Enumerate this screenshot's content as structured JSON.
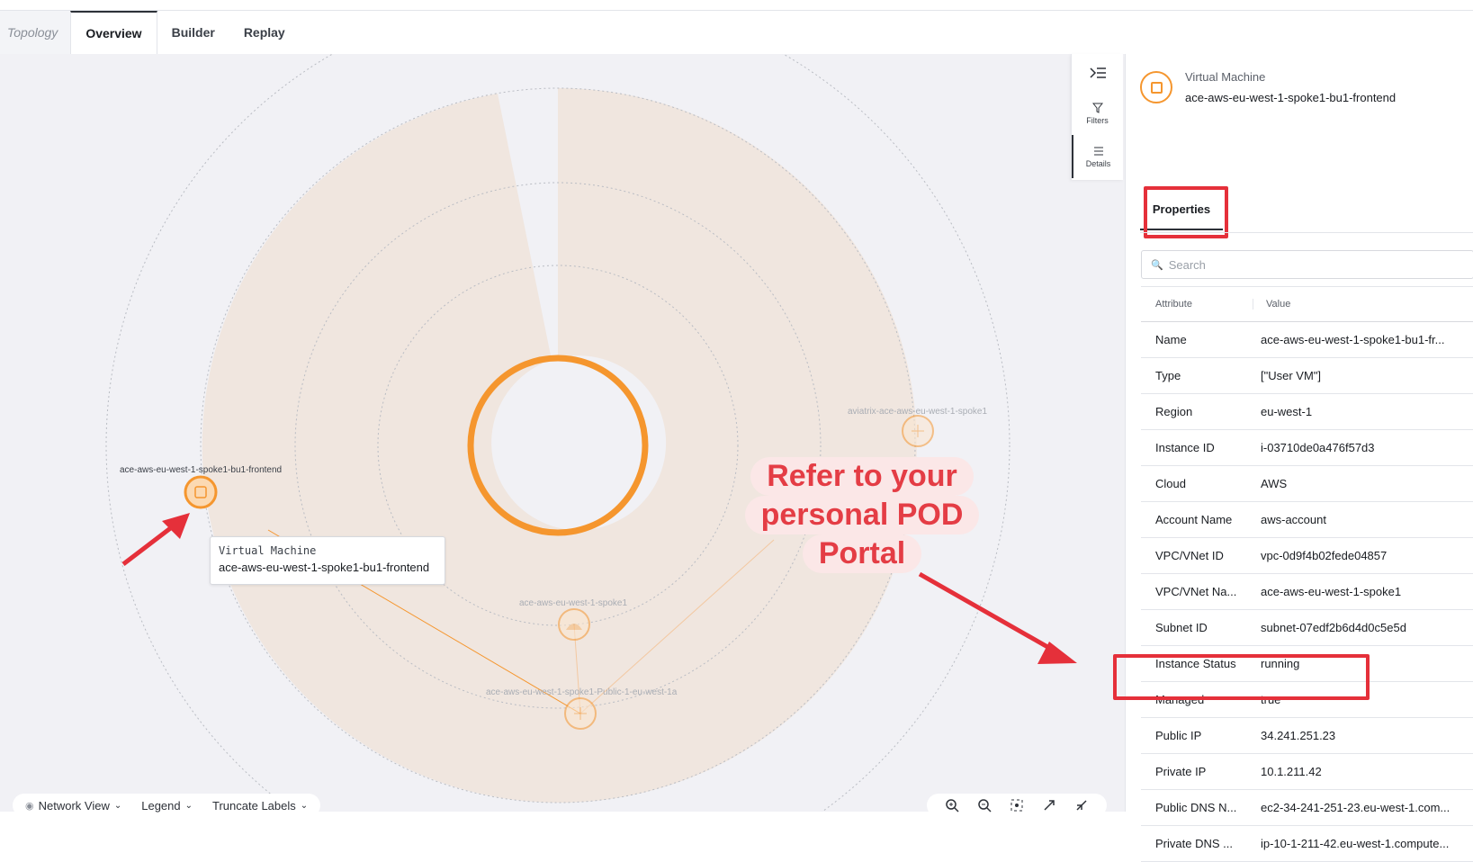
{
  "tabs": {
    "topology": "Topology",
    "overview": "Overview",
    "builder": "Builder",
    "replay": "Replay"
  },
  "canvas": {
    "node_labels": {
      "frontend": "ace-aws-eu-west-1-spoke1-bu1-frontend",
      "spoke_gw": "aviatrix-ace-aws-eu-west-1-spoke1",
      "spoke_vpc": "ace-aws-eu-west-1-spoke1",
      "subnet": "ace-aws-eu-west-1-spoke1-Public-1-eu-west-1a"
    },
    "tooltip": {
      "kind": "Virtual Machine",
      "name": "ace-aws-eu-west-1-spoke1-bu1-frontend"
    },
    "callout": {
      "line1": "Refer to your",
      "line2": "personal POD",
      "line3": "Portal"
    },
    "colors": {
      "accent": "#f5962e",
      "annotation": "#e5303a",
      "sector_fill": "#f0e6df"
    }
  },
  "bottom_toolbar": {
    "network_view": "Network View",
    "legend": "Legend",
    "truncate_labels": "Truncate Labels"
  },
  "rail": {
    "filters": "Filters",
    "details": "Details"
  },
  "panel": {
    "kind": "Virtual Machine",
    "name": "ace-aws-eu-west-1-spoke1-bu1-frontend",
    "tab_properties": "Properties",
    "search_placeholder": "Search",
    "columns": {
      "attribute": "Attribute",
      "value": "Value"
    },
    "rows": [
      {
        "attribute": "Name",
        "value": "ace-aws-eu-west-1-spoke1-bu1-fr..."
      },
      {
        "attribute": "Type",
        "value": "[\"User VM\"]"
      },
      {
        "attribute": "Region",
        "value": "eu-west-1"
      },
      {
        "attribute": "Instance ID",
        "value": "i-03710de0a476f57d3"
      },
      {
        "attribute": "Cloud",
        "value": "AWS"
      },
      {
        "attribute": "Account Name",
        "value": "aws-account"
      },
      {
        "attribute": "VPC/VNet ID",
        "value": "vpc-0d9f4b02fede04857"
      },
      {
        "attribute": "VPC/VNet Na...",
        "value": "ace-aws-eu-west-1-spoke1"
      },
      {
        "attribute": "Subnet ID",
        "value": "subnet-07edf2b6d4d0c5e5d"
      },
      {
        "attribute": "Instance Status",
        "value": "running"
      },
      {
        "attribute": "Managed",
        "value": "true"
      },
      {
        "attribute": "Public IP",
        "value": "34.241.251.23"
      },
      {
        "attribute": "Private IP",
        "value": "10.1.211.42"
      },
      {
        "attribute": "Public DNS N...",
        "value": "ec2-34-241-251-23.eu-west-1.com..."
      },
      {
        "attribute": "Private DNS ...",
        "value": "ip-10-1-211-42.eu-west-1.compute..."
      }
    ]
  }
}
